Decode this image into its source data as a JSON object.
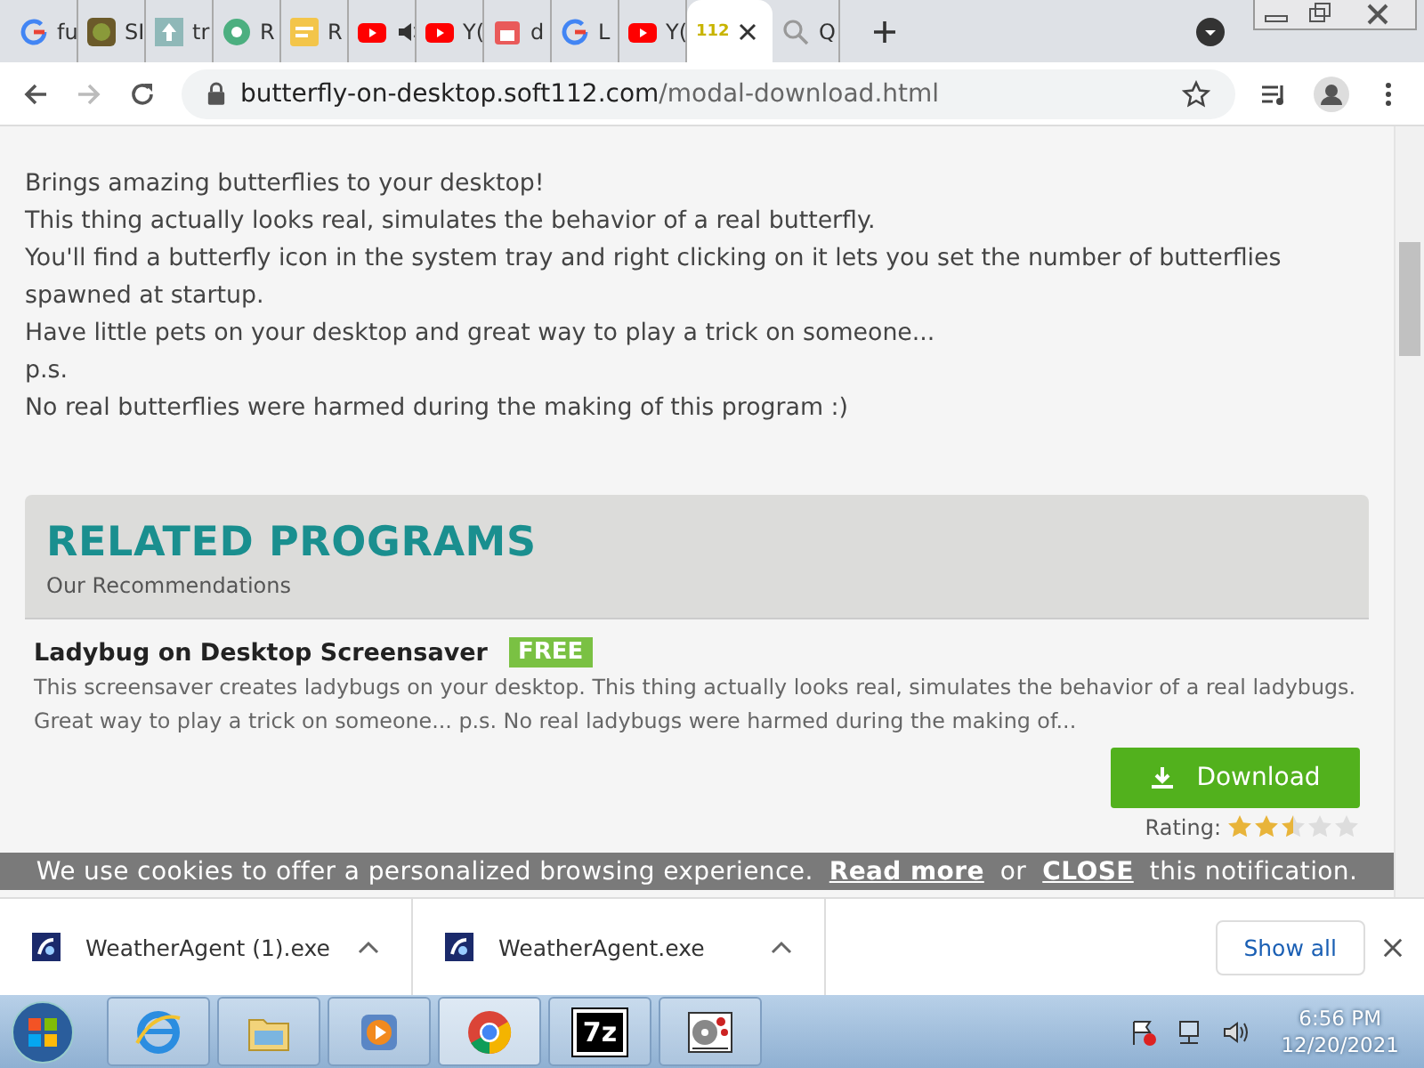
{
  "tabs": [
    {
      "kind": "google",
      "title": "fu",
      "selected": false
    },
    {
      "kind": "photo",
      "title": "SI",
      "selected": false
    },
    {
      "kind": "arrow",
      "title": "tr",
      "selected": false
    },
    {
      "kind": "circle",
      "title": "R",
      "selected": false
    },
    {
      "kind": "note",
      "title": "R",
      "selected": false
    },
    {
      "kind": "youtube",
      "audio": true,
      "selected": false
    },
    {
      "kind": "youtube",
      "title": "Y(",
      "selected": false
    },
    {
      "kind": "store",
      "title": "d",
      "selected": false
    },
    {
      "kind": "google",
      "title": "L",
      "selected": false
    },
    {
      "kind": "youtube",
      "title": "Y(",
      "selected": false
    },
    {
      "kind": "text",
      "favicon_text": "112",
      "selected": true
    },
    {
      "kind": "search",
      "title": "Q",
      "selected": false
    }
  ],
  "address": {
    "host": "butterfly-on-desktop.soft112.com",
    "path": "/modal-download.html"
  },
  "description": [
    "Brings amazing butterflies to your desktop!",
    "This thing actually looks real, simulates the behavior of a real butterfly.",
    "You'll find a butterfly icon in the system tray and right clicking on it lets you set the number of butterflies spawned at startup.",
    "Have little pets on your desktop and great way to play a trick on someone...",
    "p.s.",
    "No real butterflies were harmed during the making of this program :)"
  ],
  "related": {
    "title": "RELATED PROGRAMS",
    "subtitle": "Our Recommendations",
    "items": [
      {
        "name": "Ladybug on Desktop Screensaver",
        "badge": "FREE",
        "text": "This screensaver creates ladybugs on your desktop. This thing actually looks real, simulates the behavior of a real ladybugs. Great way to play a trick on someone... p.s. No real ladybugs were harmed during the making of...",
        "button": "Download",
        "rating_label": "Rating:",
        "stars": 2.5
      }
    ]
  },
  "cookie_bar": {
    "text": "We use cookies to offer a personalized browsing experience.",
    "link": "Read more",
    "or": "or",
    "close": "CLOSE",
    "tail": "this notification."
  },
  "downloads": {
    "items": [
      {
        "name": "WeatherAgent (1).exe"
      },
      {
        "name": "WeatherAgent.exe"
      }
    ],
    "show_all": "Show all"
  },
  "taskbar": {
    "apps": [
      {
        "kind": "ie",
        "selected": false
      },
      {
        "kind": "folder",
        "selected": false
      },
      {
        "kind": "media",
        "selected": false
      },
      {
        "kind": "chrome",
        "selected": true
      },
      {
        "kind": "zip",
        "label": "7z",
        "selected": false
      },
      {
        "kind": "film",
        "selected": false
      }
    ],
    "time": "6:56 PM",
    "date": "12/20/2021"
  }
}
